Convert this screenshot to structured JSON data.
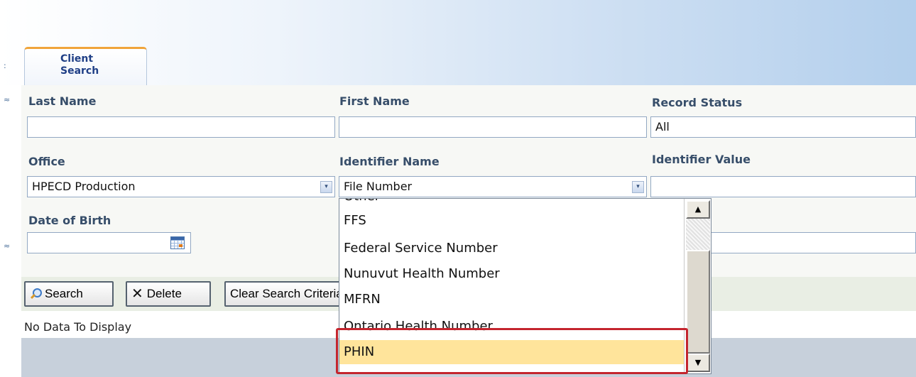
{
  "tab": {
    "label": "Client Search"
  },
  "gutter": {
    "collapse_up": "≈",
    "collapse_down": "≈",
    "top_marker": ":"
  },
  "fields": {
    "last_name": {
      "label": "Last Name",
      "value": ""
    },
    "first_name": {
      "label": "First Name",
      "value": ""
    },
    "record_status": {
      "label": "Record Status",
      "value": "All"
    },
    "office": {
      "label": "Office",
      "value": "HPECD Production"
    },
    "identifier_name": {
      "label": "Identifier Name",
      "value": "File Number"
    },
    "identifier_value": {
      "label": "Identifier Value",
      "value": ""
    },
    "date_of_birth": {
      "label": "Date of Birth",
      "value": ""
    }
  },
  "buttons": {
    "search": "Search",
    "delete": "Delete",
    "clear": "Clear Search Criteria"
  },
  "results": {
    "empty_message": "No Data To Display"
  },
  "dropdown": {
    "items": [
      {
        "label": "Other",
        "selected": false
      },
      {
        "label": "FFS",
        "selected": false
      },
      {
        "label": "Federal Service Number",
        "selected": false
      },
      {
        "label": "Nunuvut Health Number",
        "selected": false
      },
      {
        "label": "MFRN",
        "selected": false
      },
      {
        "label": "Ontario Health Number",
        "selected": false
      },
      {
        "label": "PHIN",
        "selected": true
      }
    ],
    "scroll_up": "▲",
    "scroll_down": "▼"
  },
  "icons": {
    "dropdown_arrow": "▾",
    "delete_x": "✕"
  },
  "colors": {
    "accent_tab": "#f0a43a",
    "label_text": "#374e6a",
    "selected_item": "#ffe49b",
    "highlight_border": "#c4252e"
  }
}
